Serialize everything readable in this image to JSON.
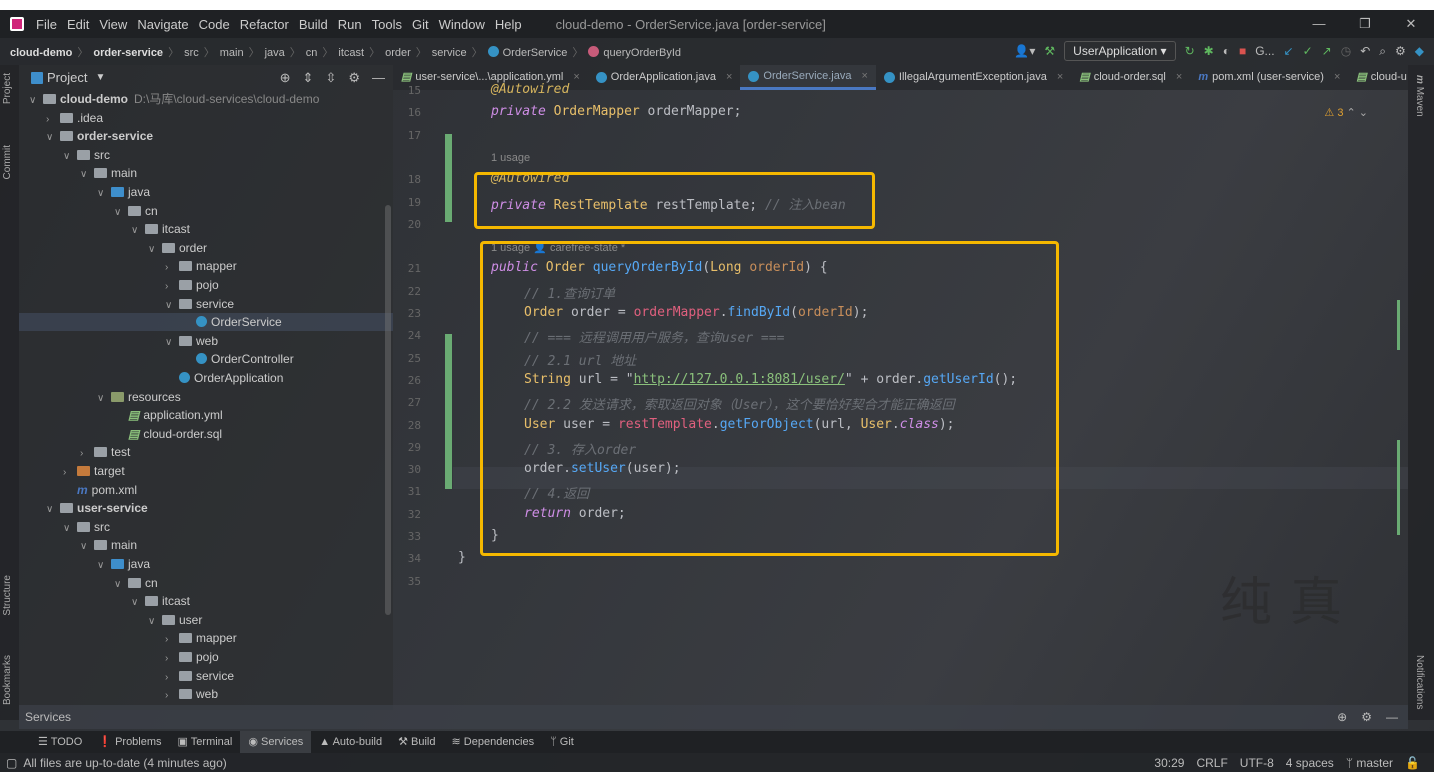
{
  "window": {
    "title": "cloud-demo - OrderService.java [order-service]",
    "menu": [
      "File",
      "Edit",
      "View",
      "Navigate",
      "Code",
      "Refactor",
      "Build",
      "Run",
      "Tools",
      "Git",
      "Window",
      "Help"
    ],
    "controls": [
      "—",
      "❐",
      "✕"
    ]
  },
  "breadcrumb": [
    "cloud-demo",
    "order-service",
    "src",
    "main",
    "java",
    "cn",
    "itcast",
    "order",
    "service",
    "OrderService",
    "queryOrderById"
  ],
  "toolbar": {
    "run_config": "UserApplication",
    "git_label": "G..."
  },
  "project_panel": {
    "title": "Project",
    "items": [
      {
        "label": "cloud-demo",
        "level": 0,
        "type": "module",
        "expanded": true,
        "path": "D:\\马库\\cloud-services\\cloud-demo",
        "bold": true
      },
      {
        "label": ".idea",
        "level": 1,
        "type": "folder",
        "expanded": false
      },
      {
        "label": "order-service",
        "level": 1,
        "type": "module",
        "expanded": true,
        "bold": true
      },
      {
        "label": "src",
        "level": 2,
        "type": "folder",
        "expanded": true
      },
      {
        "label": "main",
        "level": 3,
        "type": "folder",
        "expanded": true
      },
      {
        "label": "java",
        "level": 4,
        "type": "src",
        "expanded": true
      },
      {
        "label": "cn",
        "level": 5,
        "type": "folder",
        "expanded": true
      },
      {
        "label": "itcast",
        "level": 6,
        "type": "folder",
        "expanded": true
      },
      {
        "label": "order",
        "level": 7,
        "type": "folder",
        "expanded": true
      },
      {
        "label": "mapper",
        "level": 8,
        "type": "folder",
        "expanded": false
      },
      {
        "label": "pojo",
        "level": 8,
        "type": "folder",
        "expanded": false
      },
      {
        "label": "service",
        "level": 8,
        "type": "folder",
        "expanded": true
      },
      {
        "label": "OrderService",
        "level": 9,
        "type": "class",
        "selected": true
      },
      {
        "label": "web",
        "level": 8,
        "type": "folder",
        "expanded": true
      },
      {
        "label": "OrderController",
        "level": 9,
        "type": "class"
      },
      {
        "label": "OrderApplication",
        "level": 8,
        "type": "class"
      },
      {
        "label": "resources",
        "level": 4,
        "type": "res",
        "expanded": true
      },
      {
        "label": "application.yml",
        "level": 5,
        "type": "yml"
      },
      {
        "label": "cloud-order.sql",
        "level": 5,
        "type": "sql"
      },
      {
        "label": "test",
        "level": 3,
        "type": "folder",
        "expanded": false
      },
      {
        "label": "target",
        "level": 2,
        "type": "tgt",
        "expanded": false
      },
      {
        "label": "pom.xml",
        "level": 2,
        "type": "pom"
      },
      {
        "label": "user-service",
        "level": 1,
        "type": "module",
        "expanded": true,
        "bold": true
      },
      {
        "label": "src",
        "level": 2,
        "type": "folder",
        "expanded": true
      },
      {
        "label": "main",
        "level": 3,
        "type": "folder",
        "expanded": true
      },
      {
        "label": "java",
        "level": 4,
        "type": "src",
        "expanded": true
      },
      {
        "label": "cn",
        "level": 5,
        "type": "folder",
        "expanded": true
      },
      {
        "label": "itcast",
        "level": 6,
        "type": "folder",
        "expanded": true
      },
      {
        "label": "user",
        "level": 7,
        "type": "folder",
        "expanded": true
      },
      {
        "label": "mapper",
        "level": 8,
        "type": "folder",
        "expanded": false
      },
      {
        "label": "pojo",
        "level": 8,
        "type": "folder",
        "expanded": false
      },
      {
        "label": "service",
        "level": 8,
        "type": "folder",
        "expanded": false
      },
      {
        "label": "web",
        "level": 8,
        "type": "folder",
        "expanded": false
      }
    ]
  },
  "tabs": [
    {
      "label": "user-service\\...\\application.yml",
      "icon": "yml-icon"
    },
    {
      "label": "OrderApplication.java",
      "icon": "class-icon"
    },
    {
      "label": "OrderService.java",
      "icon": "class-icon",
      "active": true
    },
    {
      "label": "IllegalArgumentException.java",
      "icon": "class-icon"
    },
    {
      "label": "cloud-order.sql",
      "icon": "sql-icon"
    },
    {
      "label": "pom.xml (user-service)",
      "icon": "maven-icon"
    },
    {
      "label": "cloud-u",
      "icon": "sql-icon"
    }
  ],
  "editor": {
    "warnings": "3",
    "lines": [
      {
        "n": "15",
        "indent": 0,
        "tokens": [
          [
            "ann",
            "@Autowired"
          ]
        ]
      },
      {
        "n": "16",
        "indent": 0,
        "tokens": [
          [
            "kw",
            "private"
          ],
          [
            "var",
            " "
          ],
          [
            "ty",
            "OrderMapper"
          ],
          [
            "var",
            " orderMapper;"
          ]
        ]
      },
      {
        "n": "17",
        "indent": 0,
        "tokens": []
      },
      {
        "hint": "1 usage"
      },
      {
        "n": "18",
        "indent": 0,
        "tokens": [
          [
            "ann",
            "@Autowired"
          ]
        ]
      },
      {
        "n": "19",
        "indent": 0,
        "tokens": [
          [
            "kw",
            "private"
          ],
          [
            "var",
            " "
          ],
          [
            "ty",
            "RestTemplate"
          ],
          [
            "var",
            " restTemplate; "
          ],
          [
            "cm",
            "// 注入bean"
          ]
        ]
      },
      {
        "n": "20",
        "indent": 0,
        "tokens": []
      },
      {
        "hint": "1 usage    👤 carefree-state *"
      },
      {
        "n": "21",
        "indent": 0,
        "tokens": [
          [
            "kw",
            "public"
          ],
          [
            "var",
            " "
          ],
          [
            "ty",
            "Order"
          ],
          [
            "var",
            " "
          ],
          [
            "fn",
            "queryOrderById"
          ],
          [
            "var",
            "("
          ],
          [
            "ty",
            "Long"
          ],
          [
            "var",
            " "
          ],
          [
            "pm",
            "orderId"
          ],
          [
            "var",
            ") {"
          ]
        ]
      },
      {
        "n": "22",
        "indent": 1,
        "tokens": [
          [
            "cm",
            "// 1.查询订单"
          ]
        ]
      },
      {
        "n": "23",
        "indent": 1,
        "tokens": [
          [
            "ty",
            "Order"
          ],
          [
            "var",
            " order = "
          ],
          [
            "fld",
            "orderMapper"
          ],
          [
            "var",
            "."
          ],
          [
            "fn",
            "findById"
          ],
          [
            "var",
            "("
          ],
          [
            "pm",
            "orderId"
          ],
          [
            "var",
            ");"
          ]
        ]
      },
      {
        "n": "24",
        "indent": 1,
        "tokens": [
          [
            "cm",
            "// === 远程调用用户服务，查询user ==="
          ]
        ]
      },
      {
        "n": "25",
        "indent": 1,
        "tokens": [
          [
            "cm",
            "// 2.1 url 地址"
          ]
        ]
      },
      {
        "n": "26",
        "indent": 1,
        "tokens": [
          [
            "ty",
            "String"
          ],
          [
            "var",
            " url = \""
          ],
          [
            "url",
            "http://127.0.0.1:8081/user/"
          ],
          [
            "var",
            "\" + order."
          ],
          [
            "fn",
            "getUserId"
          ],
          [
            "var",
            "();"
          ]
        ]
      },
      {
        "n": "27",
        "indent": 1,
        "tokens": [
          [
            "cm",
            "// 2.2 发送请求，索取返回对象（User），这个要恰好契合才能正确返回"
          ]
        ]
      },
      {
        "n": "28",
        "indent": 1,
        "tokens": [
          [
            "ty",
            "User"
          ],
          [
            "var",
            " user = "
          ],
          [
            "fld",
            "restTemplate"
          ],
          [
            "var",
            "."
          ],
          [
            "fn",
            "getForObject"
          ],
          [
            "var",
            "(url, "
          ],
          [
            "ty",
            "User"
          ],
          [
            "var",
            "."
          ],
          [
            "kw",
            "class"
          ],
          [
            "var",
            ");"
          ]
        ]
      },
      {
        "n": "29",
        "indent": 1,
        "tokens": [
          [
            "cm",
            "// 3. 存入order"
          ]
        ]
      },
      {
        "n": "30",
        "indent": 1,
        "tokens": [
          [
            "var",
            "order."
          ],
          [
            "fn",
            "setUser"
          ],
          [
            "var",
            "(user);"
          ]
        ]
      },
      {
        "n": "31",
        "indent": 1,
        "tokens": [
          [
            "cm",
            "// 4.返回"
          ]
        ]
      },
      {
        "n": "32",
        "indent": 1,
        "tokens": [
          [
            "kw",
            "return"
          ],
          [
            "var",
            " order;"
          ]
        ]
      },
      {
        "n": "33",
        "indent": 0,
        "tokens": [
          [
            "var",
            "}"
          ]
        ]
      },
      {
        "n": "34",
        "indent": -1,
        "tokens": [
          [
            "var",
            "}"
          ]
        ]
      },
      {
        "n": "35",
        "indent": 0,
        "tokens": []
      }
    ]
  },
  "side_labels": {
    "project": "Project",
    "commit": "Commit",
    "structure": "Structure",
    "bookmarks": "Bookmarks",
    "maven": "Maven",
    "notifications": "Notifications"
  },
  "services_panel": {
    "title": "Services"
  },
  "tool_tabs": [
    "TODO",
    "Problems",
    "Terminal",
    "Services",
    "Auto-build",
    "Build",
    "Dependencies",
    "Git"
  ],
  "status": {
    "message": "All files are up-to-date (4 minutes ago)",
    "position": "30:29",
    "line_ending": "CRLF",
    "encoding": "UTF-8",
    "indent": "4 spaces",
    "branch": "master"
  },
  "watermark": "纯真",
  "colors": {
    "highlight_box": "#f5b800",
    "vcs_added": "#6aab73",
    "accent": "#4a78c2"
  }
}
